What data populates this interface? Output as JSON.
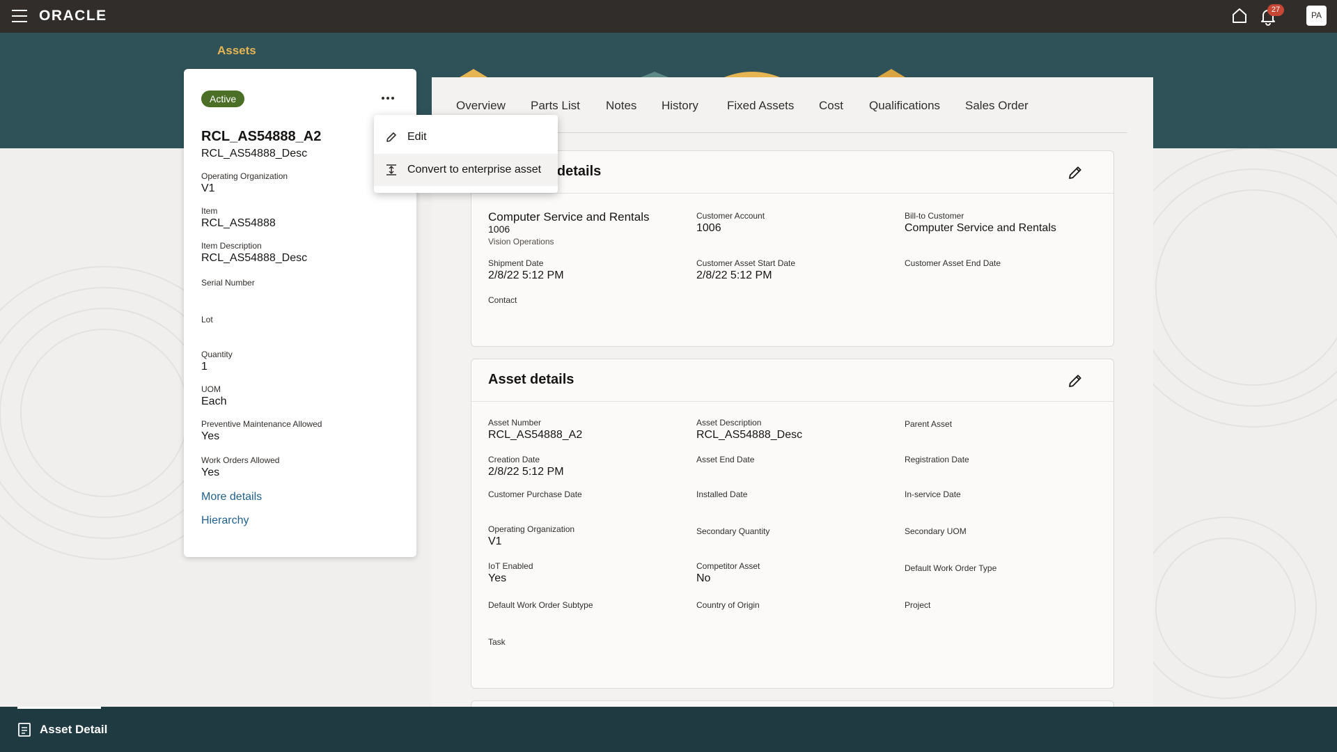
{
  "header": {
    "logo": "ORACLE",
    "notification_count": "27",
    "avatar_initials": "PA"
  },
  "breadcrumb": "Assets",
  "left_card": {
    "status": "Active",
    "title": "RCL_AS54888_A2",
    "subtitle": "RCL_AS54888_Desc",
    "fields": [
      {
        "label": "Operating Organization",
        "value": "V1"
      },
      {
        "label": "Item",
        "value": "RCL_AS54888"
      },
      {
        "label": "Item Description",
        "value": "RCL_AS54888_Desc"
      },
      {
        "label": "Serial Number",
        "value": ""
      },
      {
        "label": "Lot",
        "value": ""
      },
      {
        "label": "Quantity",
        "value": "1"
      },
      {
        "label": "UOM",
        "value": "Each"
      },
      {
        "label": "Preventive Maintenance Allowed",
        "value": "Yes"
      },
      {
        "label": "Work Orders Allowed",
        "value": "Yes"
      }
    ],
    "links": [
      "More details",
      "Hierarchy"
    ]
  },
  "menu": {
    "items": [
      "Edit",
      "Convert to enterprise asset"
    ]
  },
  "tabs": [
    "Overview",
    "Parts List",
    "Notes",
    "History",
    "Fixed Assets",
    "Cost",
    "Qualifications",
    "Sales Order"
  ],
  "customer_section": {
    "title": "Customer details",
    "customer_name": "Computer Service and Rentals",
    "customer_number": "1006",
    "customer_org": "Vision Operations",
    "fields": [
      {
        "label": "Customer Account",
        "value": "1006"
      },
      {
        "label": "Bill-to Customer",
        "value": "Computer Service and Rentals"
      },
      {
        "label": "Shipment Date",
        "value": "2/8/22 5:12 PM"
      },
      {
        "label": "Customer Asset Start Date",
        "value": "2/8/22 5:12 PM"
      },
      {
        "label": "Customer Asset End Date",
        "value": ""
      },
      {
        "label": "Contact",
        "value": ""
      }
    ]
  },
  "asset_section": {
    "title": "Asset details",
    "fields": [
      {
        "label": "Asset Number",
        "value": "RCL_AS54888_A2"
      },
      {
        "label": "Asset Description",
        "value": "RCL_AS54888_Desc"
      },
      {
        "label": "Parent Asset",
        "value": ""
      },
      {
        "label": "Creation Date",
        "value": "2/8/22 5:12 PM"
      },
      {
        "label": "Asset End Date",
        "value": ""
      },
      {
        "label": "Registration Date",
        "value": ""
      },
      {
        "label": "Customer Purchase Date",
        "value": ""
      },
      {
        "label": "Installed Date",
        "value": ""
      },
      {
        "label": "In-service Date",
        "value": ""
      },
      {
        "label": "Operating Organization",
        "value": "V1"
      },
      {
        "label": "Secondary Quantity",
        "value": ""
      },
      {
        "label": "Secondary UOM",
        "value": ""
      },
      {
        "label": "IoT Enabled",
        "value": "Yes"
      },
      {
        "label": "Competitor Asset",
        "value": "No"
      },
      {
        "label": "Default Work Order Type",
        "value": ""
      },
      {
        "label": "Default Work Order Subtype",
        "value": ""
      },
      {
        "label": "Country of Origin",
        "value": ""
      },
      {
        "label": "Project",
        "value": ""
      },
      {
        "label": "Task",
        "value": ""
      }
    ]
  },
  "footer": {
    "tab_label": "Asset Detail"
  },
  "colors": {
    "topbar": "#312d2a",
    "hero": "#2f5259",
    "badge": "#4b6f26",
    "breadcrumb": "#e6b552",
    "link": "#1e5f8c",
    "footer": "#1f3a40"
  }
}
